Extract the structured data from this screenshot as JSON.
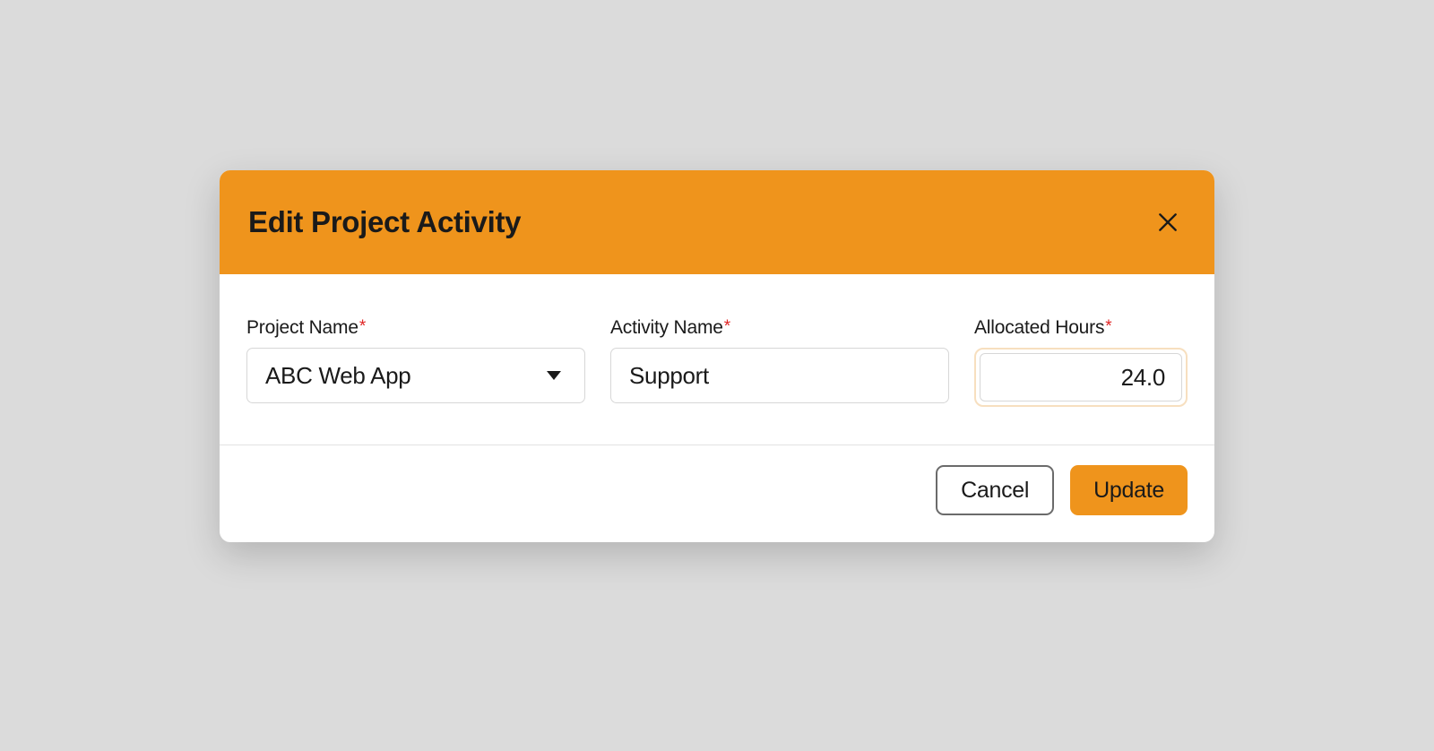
{
  "dialog": {
    "title": "Edit Project Activity",
    "required_marker": "*"
  },
  "fields": {
    "project_name": {
      "label": "Project Name",
      "value": "ABC Web App"
    },
    "activity_name": {
      "label": "Activity Name",
      "value": "Support"
    },
    "allocated_hours": {
      "label": "Allocated Hours",
      "value": "24.0"
    }
  },
  "buttons": {
    "cancel": "Cancel",
    "update": "Update"
  }
}
